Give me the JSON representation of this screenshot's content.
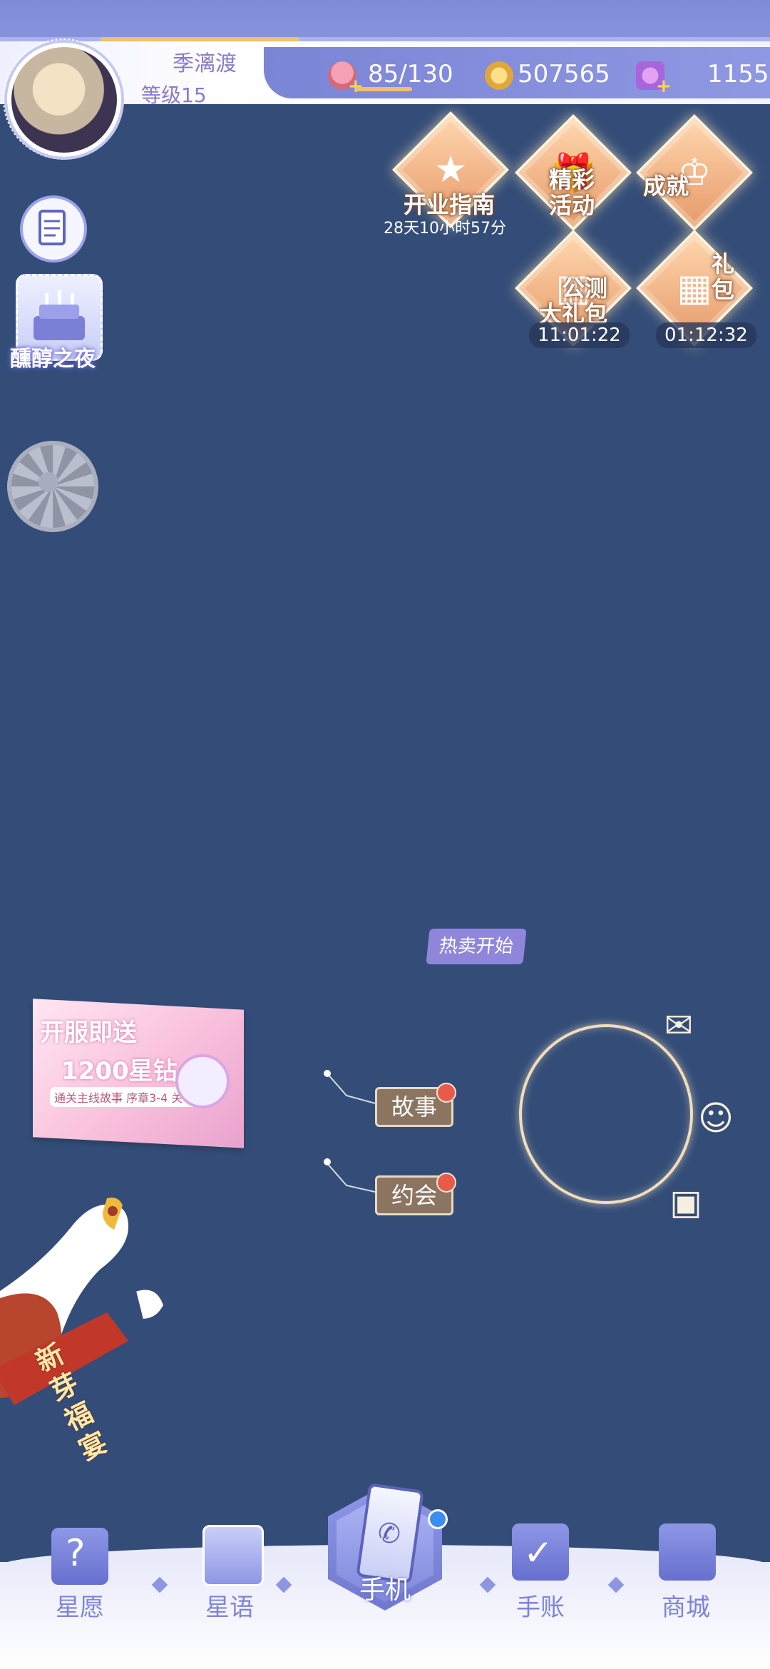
{
  "player": {
    "name": "季漓渡",
    "level": "等级15"
  },
  "resources": {
    "stamina": "85/130",
    "coins": "507565",
    "gems": "1155"
  },
  "side_menu": {
    "event_label": "醺醇之夜"
  },
  "activities": [
    {
      "label": "开业指南",
      "timer": "28天10小时57分"
    },
    {
      "label": "精彩\n活动"
    },
    {
      "label": "成就"
    },
    {
      "label": "公测\n大礼包",
      "timer": "11:01:22"
    },
    {
      "label": "礼\n包",
      "timer": "01:12:32"
    }
  ],
  "hot_sale": "热卖开始",
  "banner": {
    "line1": "开服即送",
    "line2": "1200星钻",
    "line3": "通关主线故事 序章3-4 关卡"
  },
  "nodes": {
    "story": "故事",
    "date": "约会"
  },
  "mascot": {
    "scroll_text": "新芽福宴"
  },
  "nav": {
    "wish": "星愿",
    "cards": "星语",
    "phone": "手机",
    "journal": "手账",
    "shop": "商城"
  },
  "icons": {
    "memo": "memo-icon",
    "cake": "birthday-cake-icon",
    "spin": "spinner-icon",
    "mail": "mail-icon",
    "couple": "couple-icon",
    "bag": "shopping-bag-icon"
  }
}
